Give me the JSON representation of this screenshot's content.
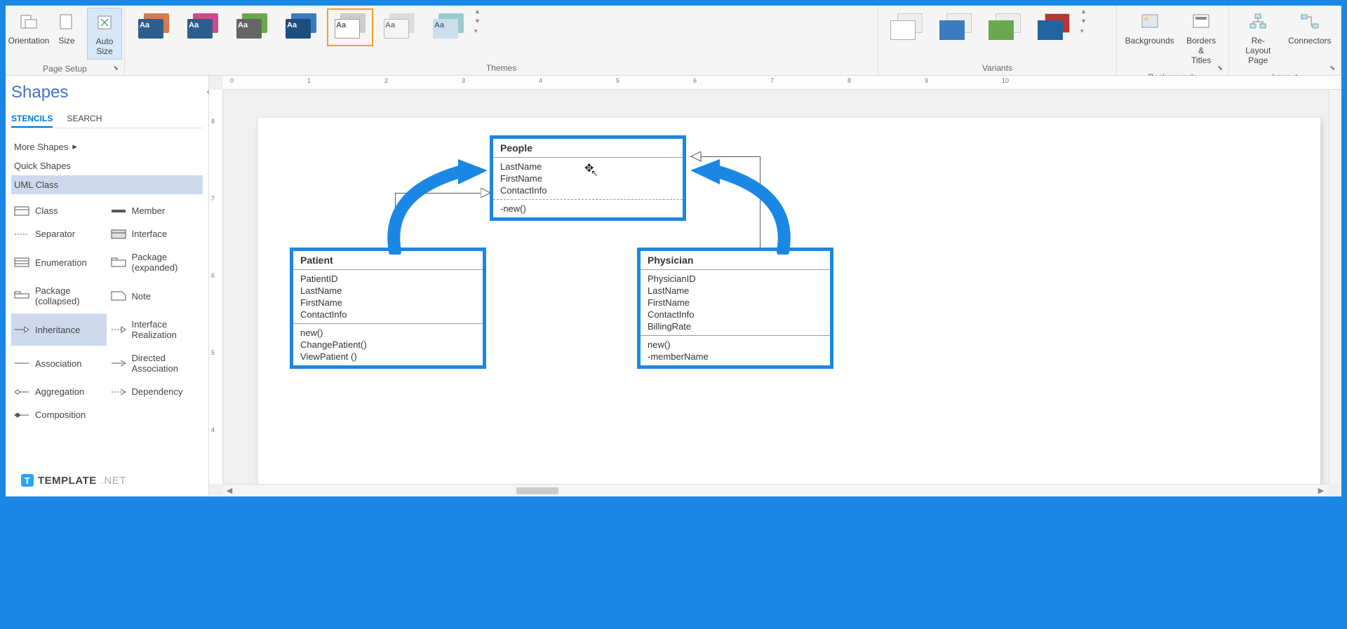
{
  "ribbon": {
    "page_setup": {
      "label": "Page Setup",
      "orientation": "Orientation",
      "size": "Size",
      "autosize": "Auto\nSize"
    },
    "themes": {
      "label": "Themes"
    },
    "variants": {
      "label": "Variants"
    },
    "backgrounds_group": {
      "label": "Backgrounds",
      "backgrounds": "Backgrounds",
      "borders": "Borders &\nTitles"
    },
    "layout_group": {
      "label": "Layout",
      "relayout": "Re-Layout\nPage",
      "connectors": "Connectors"
    }
  },
  "shapes": {
    "title": "Shapes",
    "tabs": {
      "stencils": "STENCILS",
      "search": "SEARCH"
    },
    "more": "More Shapes",
    "quick": "Quick Shapes",
    "uml_class": "UML Class",
    "items": {
      "class": "Class",
      "member": "Member",
      "separator": "Separator",
      "interface": "Interface",
      "enum": "Enumeration",
      "pkg_exp": "Package\n(expanded)",
      "pkg_col": "Package\n(collapsed)",
      "note": "Note",
      "inheritance": "Inheritance",
      "iface_real": "Interface\nRealization",
      "association": "Association",
      "dir_assoc": "Directed\nAssociation",
      "aggregation": "Aggregation",
      "dependency": "Dependency",
      "composition": "Composition"
    }
  },
  "uml": {
    "people": {
      "title": "People",
      "attrs": [
        "LastName",
        "FirstName",
        "ContactInfo"
      ],
      "ops": [
        "-new()"
      ]
    },
    "patient": {
      "title": "Patient",
      "attrs": [
        "PatientID",
        "LastName",
        "FirstName",
        "ContactInfo"
      ],
      "ops": [
        "new()",
        "ChangePatient()",
        "ViewPatient ()"
      ]
    },
    "physician": {
      "title": "Physician",
      "attrs": [
        "PhysicianID",
        "LastName",
        "FirstName",
        "ContactInfo",
        "BillingRate"
      ],
      "ops": [
        "new()",
        "-memberName"
      ]
    }
  },
  "ruler_h": [
    "0",
    "1",
    "2",
    "3",
    "4",
    "5",
    "6",
    "7",
    "8",
    "9",
    "10"
  ],
  "ruler_v": [
    "8",
    "7",
    "6",
    "5",
    "4"
  ],
  "watermark": {
    "brand": "TEMPLATE",
    "suffix": ".NET"
  }
}
